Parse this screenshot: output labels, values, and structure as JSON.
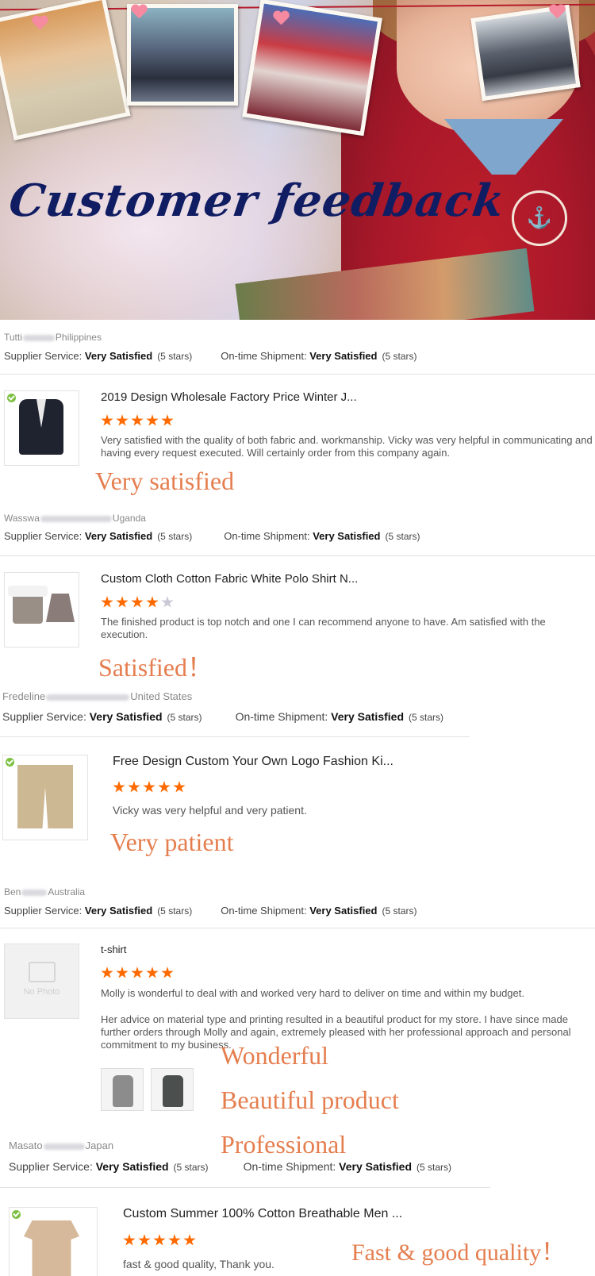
{
  "banner": {
    "title": "Customer feedback"
  },
  "reviews": [
    {
      "reviewer_first": "Tutti",
      "reviewer_country": "Philippines",
      "supplier_label": "Supplier Service:",
      "supplier_value": "Very Satisfied",
      "supplier_stars": "(5 stars)",
      "shipment_label": "On-time Shipment:",
      "shipment_value": "Very Satisfied",
      "shipment_stars": "(5 stars)",
      "product_title": "2019 Design Wholesale Factory Price Winter J...",
      "rating": 5,
      "comment": "Very satisfied with the quality of both fabric and. workmanship. Vicky was very helpful in communicating and having every request executed.  Will certainly order from this company again.",
      "annotation": "Very satisfied"
    },
    {
      "reviewer_first": "Wasswa",
      "reviewer_country": "Uganda",
      "supplier_label": "Supplier Service:",
      "supplier_value": "Very Satisfied",
      "supplier_stars": "(5 stars)",
      "shipment_label": "On-time Shipment:",
      "shipment_value": "Very Satisfied",
      "shipment_stars": "(5 stars)",
      "product_title": "Custom Cloth Cotton Fabric White Polo Shirt N...",
      "rating": 4,
      "comment": "The finished product is top notch and one I can recommend anyone to have. Am satisfied with the execution.",
      "annotation": "Satisfied！"
    },
    {
      "reviewer_first": "Fredeline",
      "reviewer_country": "United States",
      "supplier_label": "Supplier Service:",
      "supplier_value": "Very Satisfied",
      "supplier_stars": "(5 stars)",
      "shipment_label": "On-time Shipment:",
      "shipment_value": "Very Satisfied",
      "shipment_stars": "(5 stars)",
      "product_title": "Free Design Custom Your Own Logo Fashion Ki...",
      "rating": 5,
      "comment": "Vicky was very helpful and very patient.",
      "annotation": "Very patient"
    },
    {
      "reviewer_first": "Ben",
      "reviewer_country": "Australia",
      "supplier_label": "Supplier Service:",
      "supplier_value": "Very Satisfied",
      "supplier_stars": "(5 stars)",
      "shipment_label": "On-time Shipment:",
      "shipment_value": "Very Satisfied",
      "shipment_stars": "(5 stars)",
      "product_title": "t-shirt",
      "rating": 5,
      "comment": "Molly is wonderful to deal with and worked very hard to deliver on time and within my budget.",
      "comment2": "Her advice on material type and printing resulted in a beautiful product for my store.  I have since made further orders through Molly and again, extremely pleased with her professional approach and personal commitment to my business.",
      "no_photo": "No Photo",
      "annotations": [
        "Wonderful",
        "Beautiful product",
        "Professional"
      ]
    },
    {
      "reviewer_first": "Masato",
      "reviewer_country": "Japan",
      "supplier_label": "Supplier Service:",
      "supplier_value": "Very Satisfied",
      "supplier_stars": "(5 stars)",
      "shipment_label": "On-time Shipment:",
      "shipment_value": "Very Satisfied",
      "shipment_stars": "(5 stars)",
      "product_title": "Custom Summer 100% Cotton Breathable Men ...",
      "rating": 5,
      "comment": "fast & good quality, Thank you.",
      "annotation": "Fast & good quality！"
    }
  ],
  "colors": {
    "star_on": "#ff6a00",
    "star_off": "#c9c9d6",
    "annotation": "#e57e4f",
    "title_ink": "#111d63"
  }
}
